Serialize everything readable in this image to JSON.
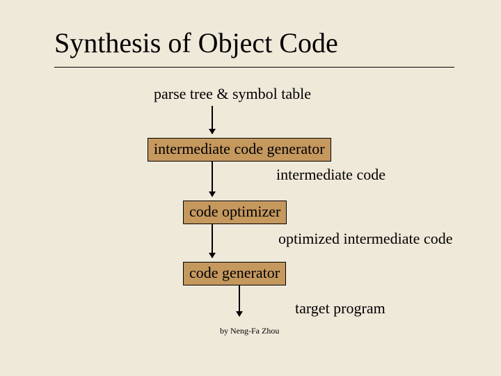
{
  "title": "Synthesis of Object Code",
  "labels": {
    "input": "parse tree & symbol table",
    "intermediate": "intermediate code",
    "optimized": "optimized intermediate code",
    "target": "target program"
  },
  "boxes": {
    "icg": "intermediate code generator",
    "optimizer": "code optimizer",
    "codegen": "code generator"
  },
  "footer": "by Neng-Fa Zhou"
}
